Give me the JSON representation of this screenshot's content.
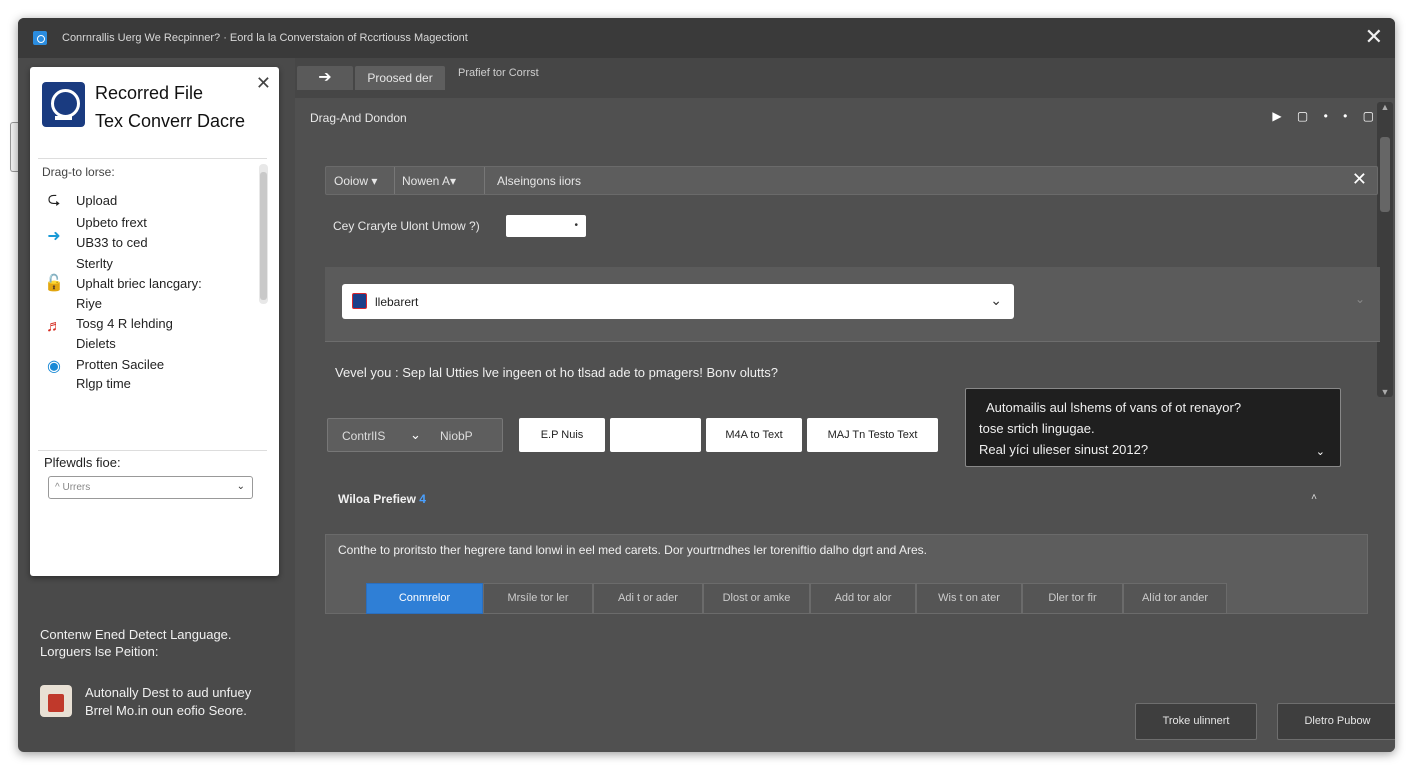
{
  "window": {
    "title": "Conrnrallis Uerg We Recpinner? · Eord la la Converstaion of Rccrtiouss Magectiont",
    "close_glyph": "✕"
  },
  "tabs": {
    "arrow": "➔",
    "active": "Proosed der",
    "other": "Prafief tor Corrst"
  },
  "main": {
    "section_title": "Drag-And Dondon",
    "mini_controls": "▶ ▢ • • ▢",
    "filter": {
      "sort": "Ooiow ▾",
      "order": "Nowen  A▾",
      "search": "Alseingons iiors",
      "clear": "✕"
    },
    "question_label": "Cey Craryte Ulont Umow ?)",
    "question_input": "•",
    "select": {
      "value": "llebarert",
      "chevron": "⌄",
      "panel_chevron": "⌄"
    },
    "prompt": "Vevel you : Sep lal Utties lve ingeen ot ho tlsad ade to pmagers! Bonv olutts?",
    "buttons": {
      "dropdown_left": "ContrlIS",
      "dropdown_chevron": "⌄",
      "dropdown_right": "NiobP",
      "b1": "E.P Nuis",
      "b2": "",
      "b3": "M4A to Text",
      "b4": "MAJ Tn Testo Text"
    },
    "tooltip": {
      "line1": "Automailis aul lshems of vans of ot renayor?",
      "line2": "tose srtich lingugae.",
      "line3": "Real yíci ulieser sinust 2012?",
      "chevron": "⌄"
    },
    "preview": {
      "label": "Wiloa Prefiew",
      "accent": "4",
      "caret": "˄",
      "description": "Conthe to proritsto ther hegrere tand lonwi in eel med carets. Dor yourtrndhes ler toreniftio dalho dgrt and Ares.",
      "segments": [
        "Conmrelor",
        "Mrsíle tor ler",
        "Adi t or ader",
        "Dlost or amke",
        "Add tor alor",
        "Wis t on ater",
        "Dler tor fir",
        "Alíd tor ander"
      ]
    },
    "actions": {
      "primary": "Troke ulinnert",
      "secondary": "Dletro Pubow"
    }
  },
  "left_panel": {
    "title_line1": "Recorred File",
    "title_line2": "Tex Converr Dacre",
    "close": "✕",
    "drag_label": "Drag-to lorse:",
    "items": [
      {
        "icon": "⮎",
        "label": "Upload"
      },
      {
        "icon": "",
        "label": "Upbeto frext"
      },
      {
        "icon": "➜",
        "label": "UB33 to ced"
      },
      {
        "icon": "",
        "label": "Sterlty"
      },
      {
        "icon": "🔓",
        "label": "Uphalt briec lancgary:"
      },
      {
        "icon": "",
        "label": "Riye"
      },
      {
        "icon": "♬",
        "label": "Tosg 4 R lehding"
      },
      {
        "icon": "",
        "label": "Dielets"
      },
      {
        "icon": "◉",
        "label": "Protten Sacilee"
      },
      {
        "icon": "",
        "label": "Rlgp time"
      }
    ],
    "pref_label": "Plfewdls fioe:",
    "pref_select_value": "^ Urrers",
    "pref_select_chevron": "⌄"
  },
  "side_notes": {
    "line1": "Contenw Ened Detect Language.",
    "line2": "Lorguers lse Peition:",
    "bottom_line1": "Autonally Dest to aud unfuey",
    "bottom_line2": "Brrel Mo.in oun eofio Seore."
  },
  "colors": {
    "accent": "#2f7fd6",
    "window_bg": "#4a4a4a",
    "titlebar_bg": "#3a3a3a"
  }
}
